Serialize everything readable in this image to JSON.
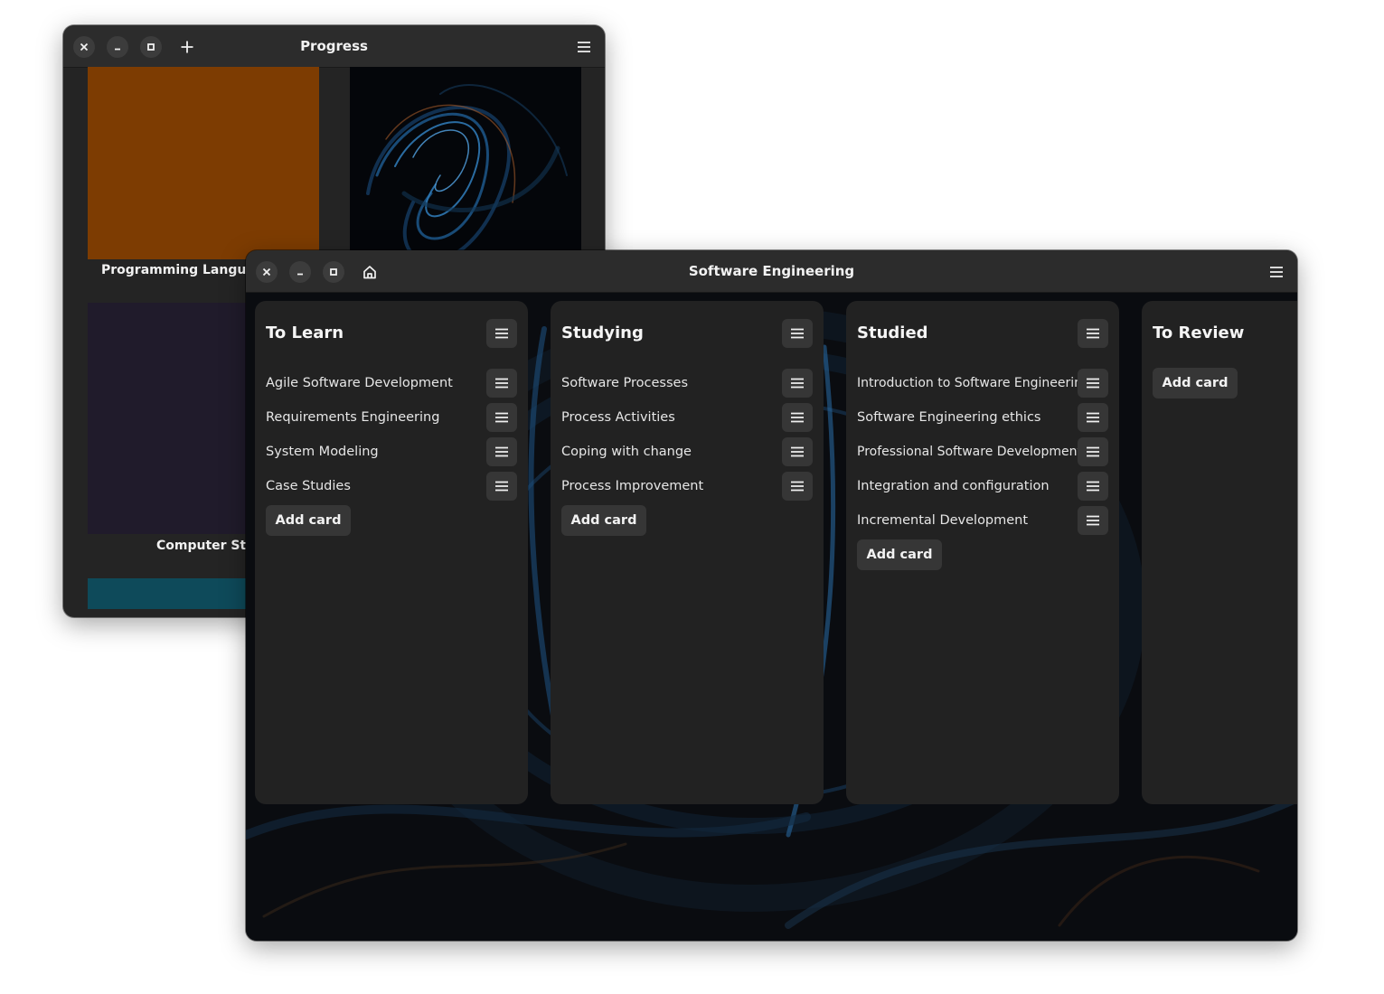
{
  "progress_window": {
    "title": "Progress",
    "tiles": [
      {
        "label": "Programming Language",
        "color": "#7d3c02"
      },
      {
        "label": "",
        "color": "#050608"
      },
      {
        "label": "Computer Stuf",
        "color": "#201b2b"
      },
      {
        "label": "",
        "color": "#0e4a5a"
      }
    ],
    "icons": [
      "close-icon",
      "minimize-icon",
      "maximize-icon",
      "plus-icon",
      "hamburger-menu-icon"
    ]
  },
  "se_window": {
    "title": "Software Engineering",
    "icons": [
      "close-icon",
      "minimize-icon",
      "maximize-icon",
      "home-icon",
      "hamburger-menu-icon"
    ],
    "columns": [
      {
        "title": "To Learn",
        "cards": [
          "Agile Software Development",
          "Requirements Engineering",
          "System Modeling",
          "Case Studies"
        ],
        "add_label": "Add card"
      },
      {
        "title": "Studying",
        "cards": [
          "Software Processes",
          "Process Activities",
          "Coping with change",
          "Process Improvement"
        ],
        "add_label": "Add card"
      },
      {
        "title": "Studied",
        "cards": [
          "Introduction to Software Engineering",
          "Software Engineering ethics",
          "Professional Software Development",
          "Integration and configuration",
          "Incremental Development"
        ],
        "add_label": "Add card"
      },
      {
        "title": "To Review",
        "cards": [],
        "add_label": "Add card"
      }
    ]
  },
  "colors": {
    "titlebar": "#2c2c2c",
    "column_bg": "#222222",
    "button_bg": "#363636",
    "accent_blue": "#2a6ea8"
  }
}
